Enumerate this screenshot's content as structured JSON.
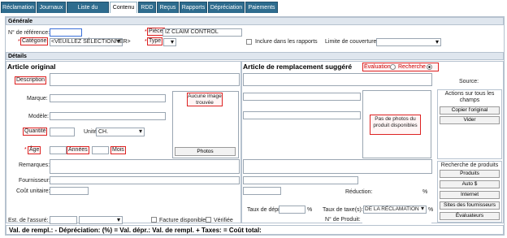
{
  "tabs": [
    "Réclamation",
    "Journaux",
    "Liste du contenu",
    "Contenu",
    "RDD",
    "Reçus",
    "Rapports",
    "Dépréciation",
    "Paiements"
  ],
  "active_tab": "Contenu",
  "generale": {
    "section": "Générale",
    "ref_label": "N° de référence:",
    "piece_label": "Pièce",
    "piece_value": "IZ CLAIM CONTROL",
    "categorie_label": "Catégorie",
    "categorie_value": "<VEUILLEZ SÉLECTIONNER>",
    "type_label": "Type",
    "inclure_label": "Inclure dans les rapports",
    "limite_label": "Limite de couverture:"
  },
  "details": {
    "section": "Détails",
    "original_title": "Article original",
    "remplacement_title": "Article de remplacement suggéré",
    "evaluation_label": "Évaluation",
    "recherche_label": "Recherche",
    "description_label": "Description",
    "marque_label": "Marque:",
    "modele_label": "Modèle:",
    "quantite_label": "Quantité",
    "unite_label": "Unité",
    "unite_value": "CH.",
    "age_label": "Âge",
    "annees_label": "Années",
    "mois_label": "Mois",
    "remarques_label": "Remarques:",
    "fournisseur_label": "Fournisseur:",
    "cout_label": "Coût unitaire:",
    "est_label": "Est. de l'assuré:",
    "facture_label": "Facture disponible",
    "verifiee_label": "Vérifiée",
    "no_image": "Aucune image trouvée",
    "photos_btn": "Photos",
    "no_photos": "Pas de photos du produit disponibles",
    "source_label": "Source:",
    "actions_title": "Actions sur tous les champs",
    "copier_btn": "Copier l'original",
    "vider_btn": "Vider",
    "reduction_label": "Réduction:",
    "percent": "%",
    "recherche_title": "Recherche de produits",
    "produits_btn": "Produits",
    "auto_btn": "Auto $",
    "internet_btn": "Internet",
    "sites_btn": "Sites des fournisseurs",
    "evaluateurs_btn": "Évaluateurs",
    "taux_depr_label": "Taux de dépr.:",
    "taux_taxe_label": "Taux de taxe(s):",
    "taux_taxe_value": "DE LA RÉCLAMATION",
    "no_produit_label": "N° de Produit:",
    "percent2": "%"
  },
  "footer": "Val. de rempl.: - Dépréciation: (%) = Val. dépr.: Val. de rempl. + Taxes: = Coût total:"
}
